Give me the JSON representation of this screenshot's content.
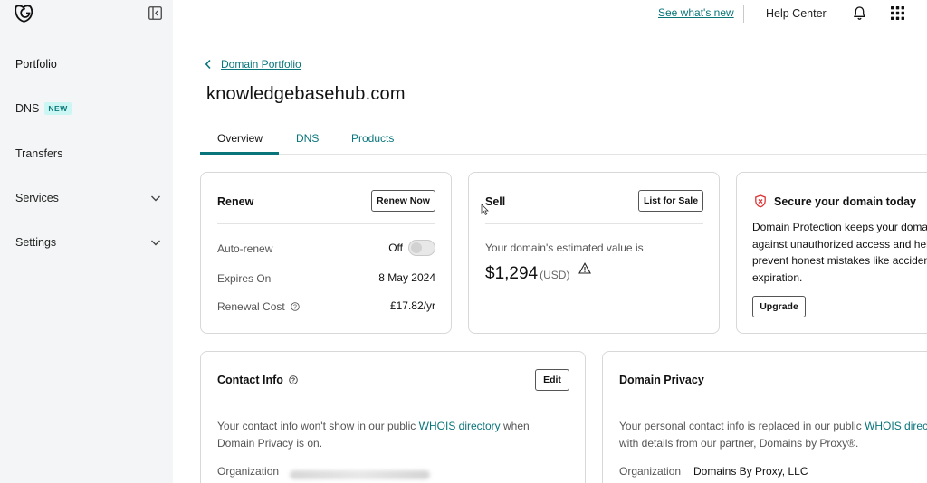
{
  "sidebar": {
    "items": [
      {
        "label": "Portfolio"
      },
      {
        "label": "DNS",
        "badge": "NEW"
      },
      {
        "label": "Transfers"
      },
      {
        "label": "Services"
      },
      {
        "label": "Settings"
      }
    ]
  },
  "topbar": {
    "whats_new": "See what's new",
    "help": "Help Center"
  },
  "header": {
    "back_label": "Domain Portfolio",
    "title": "knowledgebasehub.com",
    "tabs": [
      "Overview",
      "DNS",
      "Products"
    ]
  },
  "renew_card": {
    "title": "Renew",
    "button": "Renew Now",
    "rows": [
      {
        "label": "Auto-renew",
        "value": "Off"
      },
      {
        "label": "Expires On",
        "value": "8 May 2024"
      },
      {
        "label": "Renewal Cost",
        "value": "£17.82/yr"
      }
    ]
  },
  "sell_card": {
    "title": "Sell",
    "button": "List for Sale",
    "estimate_text": "Your domain's estimated value is",
    "price": "$1,294",
    "currency": "(USD)"
  },
  "secure_card": {
    "title": "Secure your domain today",
    "lines": [
      "Domain Protection keeps your doma",
      "against unauthorized access and hel",
      "prevent honest mistakes like acciden",
      "expiration."
    ],
    "button": "Upgrade"
  },
  "contact_card": {
    "title": "Contact Info",
    "button": "Edit",
    "text_before": "Your contact info won't show in our public ",
    "link": "WHOIS directory",
    "text_after": " when",
    "line2": "Domain Privacy is on.",
    "org_label": "Organization"
  },
  "privacy_card": {
    "title": "Domain Privacy",
    "text_before": "Your personal contact info is replaced in our public ",
    "link": "WHOIS director",
    "line2": "with details from our partner, Domains by Proxy®.",
    "org_label": "Organization",
    "org_value": "Domains By Proxy, LLC"
  },
  "colors": {
    "accent": "#09757a",
    "badge_bg": "#cbf6f4",
    "alert": "#d33"
  }
}
